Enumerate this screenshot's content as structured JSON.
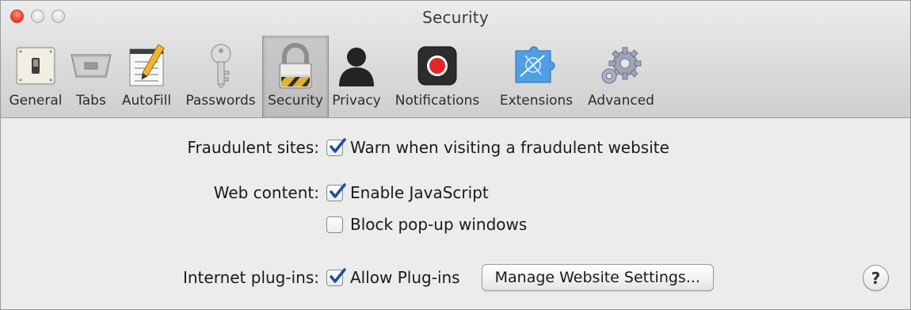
{
  "window": {
    "title": "Security"
  },
  "toolbar": {
    "items": [
      {
        "label": "General",
        "icon": "switch-icon"
      },
      {
        "label": "Tabs",
        "icon": "tabs-icon"
      },
      {
        "label": "AutoFill",
        "icon": "pencil-form-icon"
      },
      {
        "label": "Passwords",
        "icon": "key-icon"
      },
      {
        "label": "Security",
        "icon": "padlock-icon",
        "selected": true
      },
      {
        "label": "Privacy",
        "icon": "person-silhouette-icon"
      },
      {
        "label": "Notifications",
        "icon": "record-button-icon"
      },
      {
        "label": "Extensions",
        "icon": "puzzle-piece-icon"
      },
      {
        "label": "Advanced",
        "icon": "gears-icon"
      }
    ]
  },
  "settings": {
    "fraudulent": {
      "label": "Fraudulent sites:",
      "option": "Warn when visiting a fraudulent website",
      "checked": true
    },
    "web_content": {
      "label": "Web content:",
      "javascript": {
        "option": "Enable JavaScript",
        "checked": true
      },
      "popups": {
        "option": "Block pop-up windows",
        "checked": false
      }
    },
    "plugins": {
      "label": "Internet plug-ins:",
      "option": "Allow Plug-ins",
      "checked": true,
      "button": "Manage Website Settings..."
    }
  },
  "help": {
    "label": "?"
  },
  "colors": {
    "checkmark": "#1f4f9e",
    "close_button": "#f0483a",
    "record_red": "#e0282a"
  }
}
